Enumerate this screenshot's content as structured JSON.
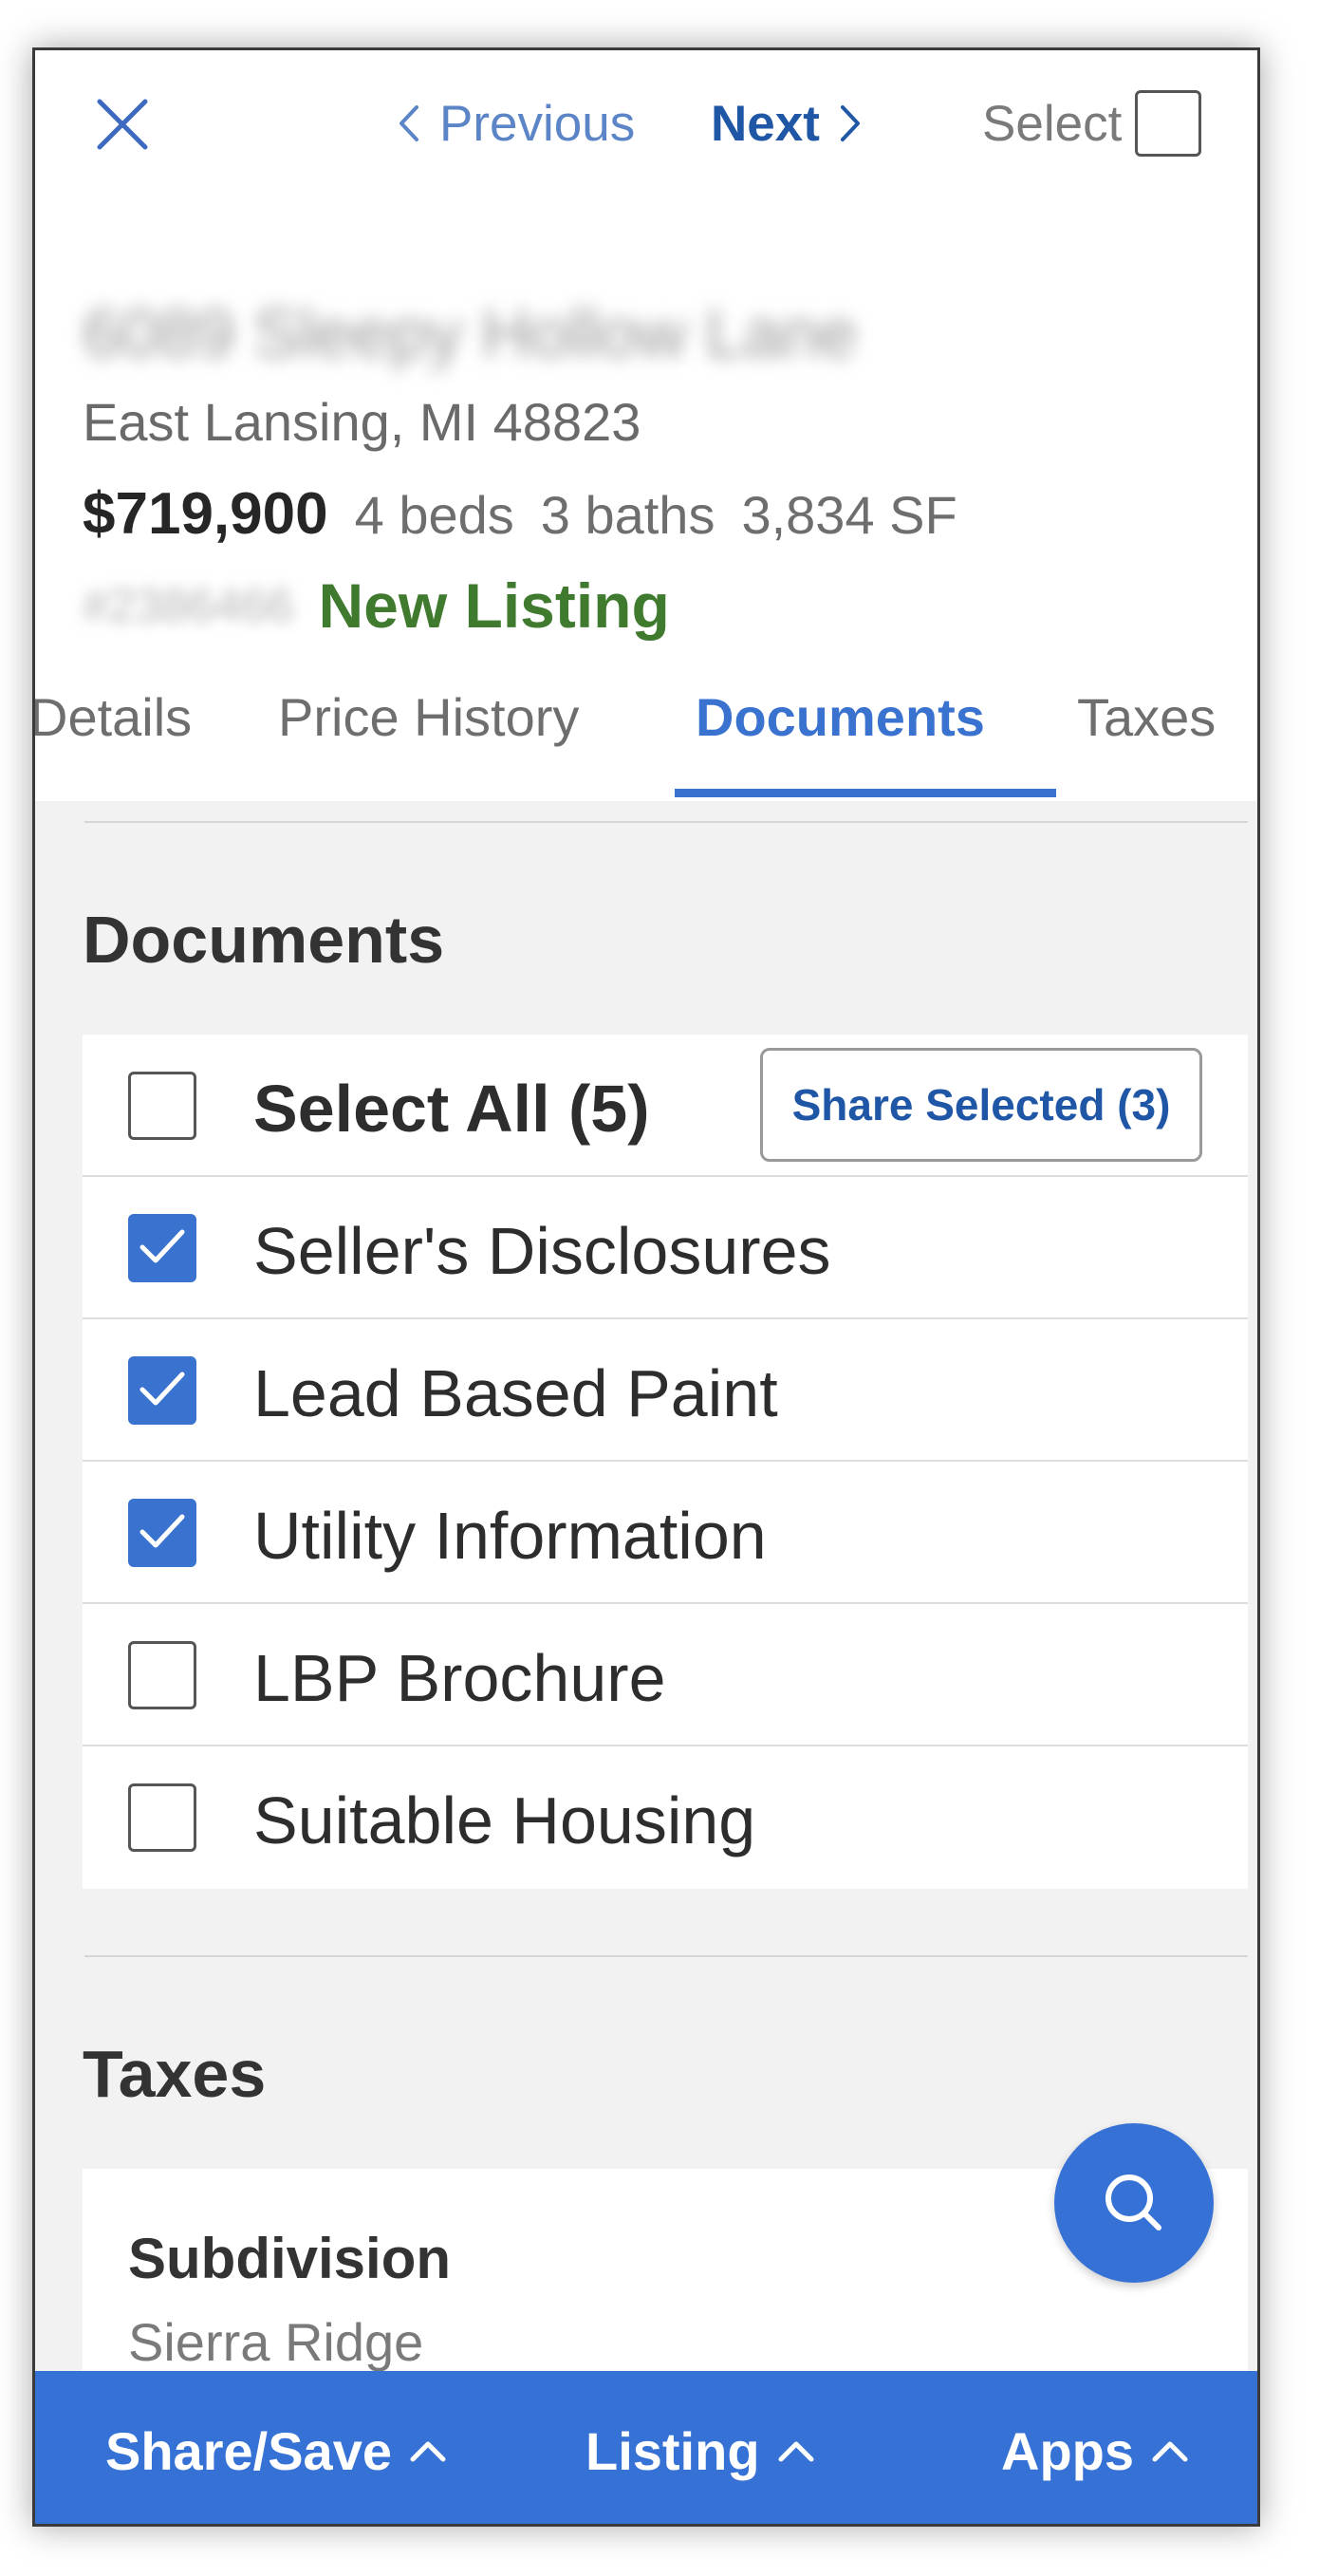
{
  "topbar": {
    "prev_label": "Previous",
    "next_label": "Next",
    "select_label": "Select"
  },
  "listing": {
    "street": "6089 Sleepy Hollow Lane",
    "city_line": "East Lansing, MI 48823",
    "price": "$719,900",
    "beds": "4 beds",
    "baths": "3 baths",
    "sqft": "3,834 SF",
    "mls_id": "#2386466",
    "status": "New Listing",
    "status_color": "#3f7a2f"
  },
  "tabs": [
    {
      "label": "Details"
    },
    {
      "label": "Price History"
    },
    {
      "label": "Documents",
      "active": true
    },
    {
      "label": "Taxes"
    }
  ],
  "documents": {
    "title": "Documents",
    "select_all_label": "Select All (5)",
    "share_label": "Share Selected (3)",
    "items": [
      {
        "label": "Seller's Disclosures",
        "checked": true
      },
      {
        "label": "Lead Based Paint",
        "checked": true
      },
      {
        "label": "Utility Information",
        "checked": true
      },
      {
        "label": "LBP Brochure",
        "checked": false
      },
      {
        "label": "Suitable Housing",
        "checked": false
      }
    ]
  },
  "taxes": {
    "title": "Taxes",
    "field_label": "Subdivision",
    "field_value": "Sierra Ridge"
  },
  "bottombar": {
    "share_save": "Share/Save",
    "listing": "Listing",
    "apps": "Apps"
  },
  "colors": {
    "accent": "#3a72cf",
    "bar": "#3672d6",
    "link_dark": "#1f56a5"
  },
  "icons": [
    "close-icon",
    "chevron-left-icon",
    "chevron-right-icon",
    "checkmark-icon",
    "search-icon",
    "caret-up-icon"
  ]
}
